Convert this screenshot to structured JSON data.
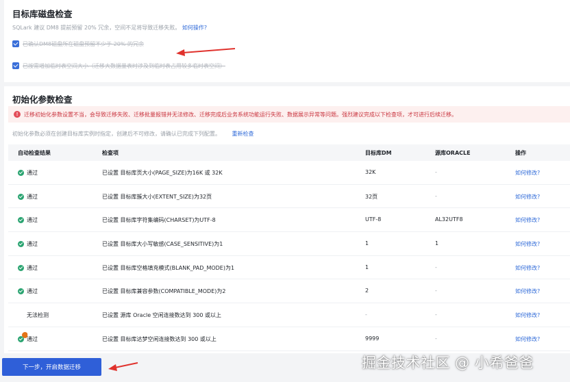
{
  "disk_check": {
    "title": "目标库磁盘检查",
    "hint": "SQLark 建议 DM8 提前预留 20% 冗余，空间不足将导致迁移失败。",
    "hint_link": "如何操作?",
    "checks": [
      {
        "label": "已确认DM8磁盘所在磁盘预留不少于 20% 的冗余",
        "checked": true
      },
      {
        "label": "已按需增加临时表空间大小（迁移大数据量表时涉及到临时表占用较多临时表空间）",
        "checked": true
      }
    ]
  },
  "param_check": {
    "title": "初始化参数检查",
    "warning": "迁移初始化参数设置不当，会导致迁移失败、迁移批量报错并无法修改、迁移完成后业务系统功能运行失败、数据展示异常等问题。强烈建议完成以下检查项，才可进行后续迁移。",
    "hint": "初始化参数必须在创建目标库实例时指定，创建后不可修改，请确认已完成下列配置。",
    "recheck_link": "重新检查",
    "columns": [
      "自动检查结果",
      "检查项",
      "目标库DM",
      "源库ORACLE",
      "操作"
    ],
    "rows": [
      {
        "status": "通过",
        "status_type": "pass",
        "item": "已设置 目标库页大小(PAGE_SIZE)为16K 或 32K",
        "target": "32K",
        "source": "-",
        "action": "如何修改?"
      },
      {
        "status": "通过",
        "status_type": "pass",
        "item": "已设置 目标库簇大小(EXTENT_SIZE)为32页",
        "target": "32页",
        "source": "-",
        "action": "如何修改?"
      },
      {
        "status": "通过",
        "status_type": "pass",
        "item": "已设置 目标库字符集编码(CHARSET)为UTF-8",
        "target": "UTF-8",
        "source": "AL32UTF8",
        "action": "如何修改?"
      },
      {
        "status": "通过",
        "status_type": "pass",
        "item": "已设置 目标库大小写敏感(CASE_SENSITIVE)为1",
        "target": "1",
        "source": "1",
        "action": "如何修改?"
      },
      {
        "status": "通过",
        "status_type": "pass",
        "item": "已设置 目标库空格填充模式(BLANK_PAD_MODE)为1",
        "target": "1",
        "source": "-",
        "action": "如何修改?"
      },
      {
        "status": "通过",
        "status_type": "pass",
        "item": "已设置 目标库兼容参数(COMPATIBLE_MODE)为2",
        "target": "2",
        "source": "-",
        "action": "如何修改?"
      },
      {
        "status": "无法检测",
        "status_type": "unknown",
        "item": "已设置 源库 Oracle 空闲连接数达到 300 或以上",
        "target": "-",
        "source": "-",
        "action": "如何修改?"
      },
      {
        "status": "通过",
        "status_type": "pass",
        "item": "已设置 目标库达梦空闲连接数达到 300 或以上",
        "target": "9999",
        "source": "-",
        "action": "如何修改?"
      }
    ]
  },
  "footer": {
    "next_button": "下一步，开启数据迁移"
  },
  "watermark": "掘金技术社区 @ 小希爸爸",
  "colors": {
    "primary": "#2f5fd8",
    "pass": "#2ba471",
    "warning": "#e37318",
    "error": "#e34d59",
    "annotation_arrow": "#e0322d"
  }
}
